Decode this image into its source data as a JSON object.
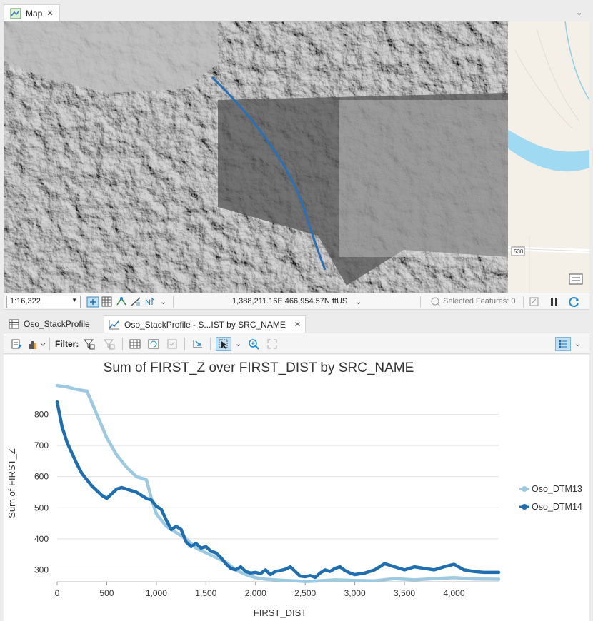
{
  "map_tab": {
    "label": "Map"
  },
  "statusbar": {
    "scale": "1:16,322",
    "coordinates": "1,388,211.16E 466,954.57N ftUS",
    "selected_features": "Selected Features: 0"
  },
  "basemap": {
    "road_label": "530"
  },
  "bottom_tabs": [
    {
      "label": "Oso_StackProfile"
    },
    {
      "label": "Oso_StackProfile - S...IST by SRC_NAME"
    }
  ],
  "toolbar": {
    "filter_label": "Filter:"
  },
  "colors": {
    "series_light": "#9ecae1",
    "series_dark": "#1f6fb0",
    "accent": "#1e88d8",
    "profile_line": "#2b6fb6"
  },
  "chart_data": {
    "type": "line",
    "title": "Sum of FIRST_Z over FIRST_DIST by SRC_NAME",
    "xlabel": "FIRST_DIST",
    "ylabel": "Sum of FIRST_Z",
    "xlim": [
      0,
      4450
    ],
    "ylim": [
      262,
      900
    ],
    "xticks": [
      0,
      500,
      1000,
      1500,
      2000,
      2500,
      3000,
      3500,
      4000
    ],
    "xtick_labels": [
      "0",
      "500",
      "1,000",
      "1,500",
      "2,000",
      "2,500",
      "3,000",
      "3,500",
      "4,000"
    ],
    "yticks": [
      300,
      400,
      500,
      600,
      700,
      800
    ],
    "ytick_labels": [
      "300",
      "400",
      "500",
      "600",
      "700",
      "800"
    ],
    "grid": true,
    "legend_position": "right",
    "series": [
      {
        "name": "Oso_DTM13",
        "color": "#9ecae1",
        "x": [
          0,
          100,
          200,
          300,
          400,
          500,
          600,
          700,
          800,
          900,
          950,
          1000,
          1100,
          1200,
          1300,
          1400,
          1500,
          1600,
          1700,
          1800,
          1900,
          2000,
          2100,
          2200,
          2300,
          2400,
          2500,
          2600,
          2700,
          2800,
          2900,
          3000,
          3200,
          3400,
          3600,
          3800,
          4000,
          4200,
          4450
        ],
        "y": [
          893,
          888,
          880,
          875,
          800,
          725,
          670,
          630,
          600,
          590,
          530,
          480,
          440,
          420,
          400,
          370,
          355,
          340,
          325,
          300,
          285,
          275,
          270,
          268,
          266,
          265,
          263,
          264,
          266,
          268,
          267,
          266,
          265,
          272,
          268,
          272,
          275,
          271,
          270
        ]
      },
      {
        "name": "Oso_DTM14",
        "color": "#1f6fb0",
        "x": [
          0,
          50,
          100,
          150,
          200,
          250,
          300,
          350,
          400,
          450,
          500,
          550,
          600,
          650,
          700,
          750,
          800,
          850,
          900,
          950,
          1000,
          1050,
          1100,
          1150,
          1200,
          1250,
          1300,
          1350,
          1400,
          1450,
          1500,
          1550,
          1600,
          1650,
          1700,
          1750,
          1800,
          1850,
          1900,
          1950,
          2000,
          2050,
          2100,
          2150,
          2200,
          2250,
          2300,
          2350,
          2400,
          2450,
          2500,
          2550,
          2600,
          2650,
          2700,
          2750,
          2800,
          2850,
          2900,
          2950,
          3000,
          3100,
          3200,
          3300,
          3400,
          3500,
          3600,
          3700,
          3800,
          3900,
          4000,
          4100,
          4200,
          4300,
          4450
        ],
        "y": [
          840,
          760,
          710,
          675,
          640,
          610,
          590,
          570,
          555,
          540,
          530,
          545,
          560,
          565,
          560,
          555,
          550,
          540,
          530,
          525,
          505,
          495,
          460,
          430,
          440,
          430,
          390,
          375,
          385,
          370,
          375,
          360,
          355,
          340,
          320,
          305,
          300,
          310,
          295,
          290,
          292,
          288,
          300,
          285,
          295,
          298,
          302,
          310,
          295,
          280,
          278,
          282,
          276,
          290,
          300,
          295,
          305,
          310,
          298,
          290,
          285,
          290,
          300,
          320,
          310,
          300,
          310,
          305,
          300,
          310,
          318,
          300,
          295,
          292,
          292
        ]
      }
    ]
  }
}
